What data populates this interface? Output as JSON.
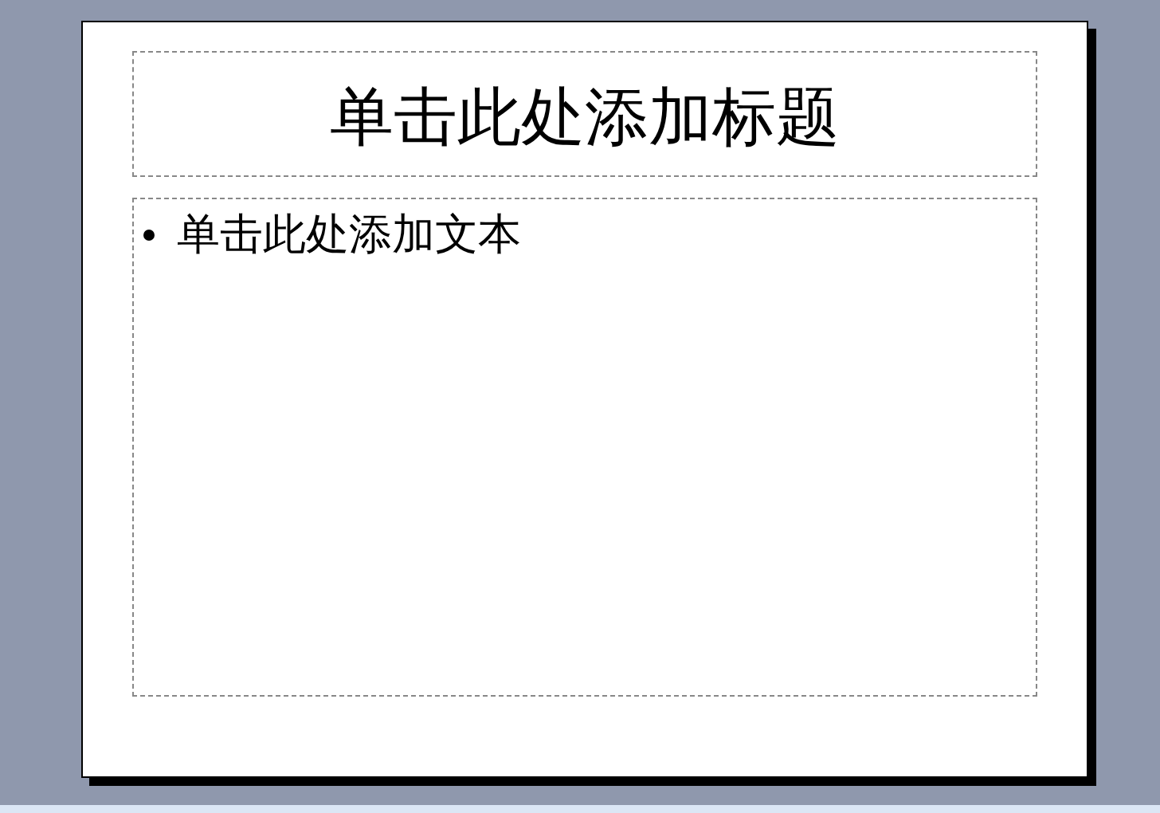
{
  "slide": {
    "title_placeholder": "单击此处添加标题",
    "body_placeholder": {
      "bullets": [
        "单击此处添加文本"
      ]
    }
  }
}
